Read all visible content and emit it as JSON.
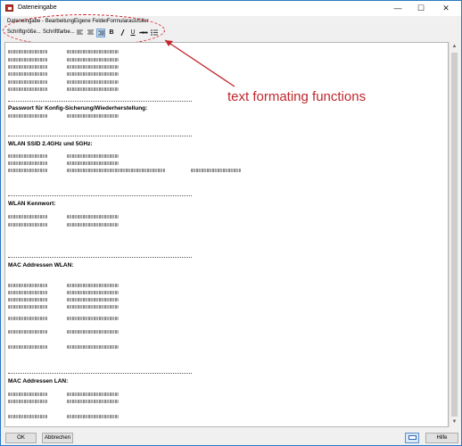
{
  "window": {
    "title": "Dateneingabe",
    "controls": {
      "minimize": "—",
      "maximize": "☐",
      "close": "✕"
    }
  },
  "menu": [
    "Dateneingabe - Bearbeitung",
    "Eigene Felder",
    "Formularausfüller"
  ],
  "toolbar": {
    "font_size_label": "Schriftgröße...",
    "font_color_label": "Schriftfarbe...",
    "buttons": [
      {
        "icon": "align-left-icon",
        "glyph": "≡"
      },
      {
        "icon": "align-center-icon",
        "glyph": "≡"
      },
      {
        "icon": "align-right-icon",
        "glyph": "≡",
        "active": true
      },
      {
        "icon": "bold-icon",
        "glyph": "B"
      },
      {
        "icon": "italic-icon",
        "glyph": "/"
      },
      {
        "icon": "underline-icon",
        "glyph": "U"
      },
      {
        "icon": "strikethrough-icon",
        "glyph": "ABC"
      },
      {
        "icon": "bullet-list-icon",
        "glyph": "⋮≡"
      }
    ]
  },
  "annotation": {
    "text": "text formating functions",
    "color": "#c0272d"
  },
  "document": {
    "headings": {
      "password": "Passwort für Konfig-Sicherung/Wiederherstellung:",
      "ssid": "WLAN SSID 2.4GHz und 5GHz:",
      "wlan_key": "WLAN Kennwort:",
      "mac_wlan": "MAC Addressen WLAN:",
      "mac_lan": "MAC Addressen LAN:"
    }
  },
  "footer": {
    "ok_label": "OK",
    "cancel_label": "Abbrechen",
    "help_label": "Hilfe"
  }
}
